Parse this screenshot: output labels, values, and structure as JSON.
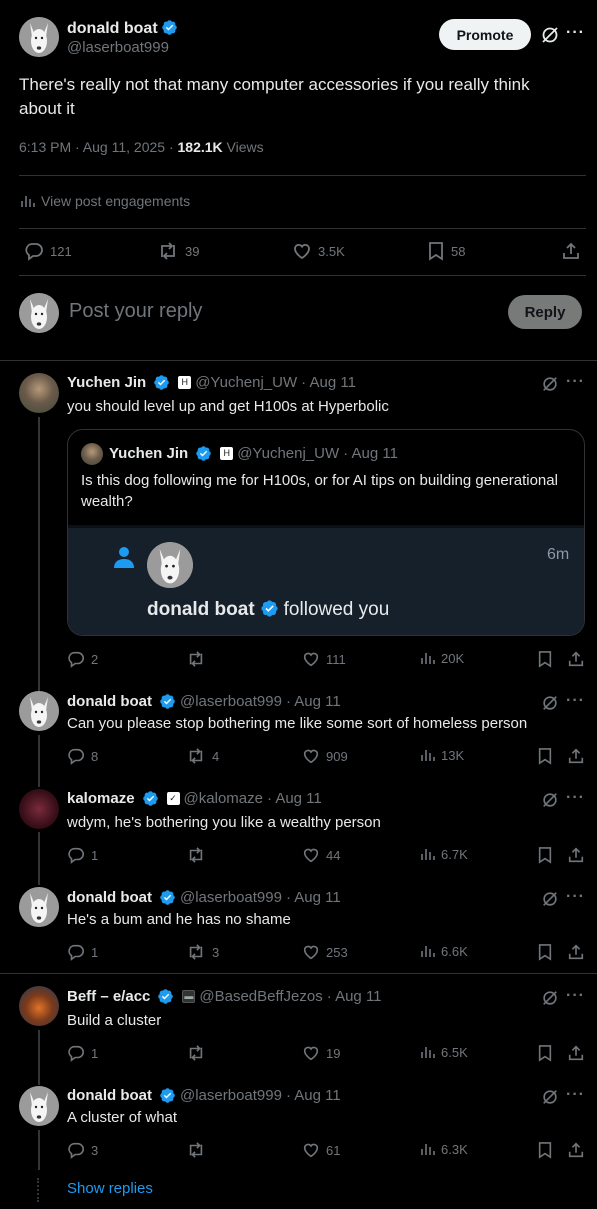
{
  "post": {
    "author_name": "donald boat",
    "author_handle": "@laserboat999",
    "promote_label": "Promote",
    "text_line1": "There's really not that many computer accessories if you really think",
    "text_line2": "about it",
    "time": "6:13 PM · Aug 11, 2025 · ",
    "views_count": "182.1K",
    "views_label": " Views",
    "engagements_label": "View post engagements",
    "metrics": {
      "replies": "121",
      "reposts": "39",
      "likes": "3.5K",
      "bookmarks": "58"
    }
  },
  "composer": {
    "placeholder": "Post your reply",
    "reply_label": "Reply"
  },
  "replies": [
    {
      "name": "Yuchen Jin",
      "handle": "@Yuchenj_UW",
      "date": "· Aug 11",
      "text": "you should level up and get H100s at Hyperbolic",
      "metrics": {
        "replies": "2",
        "reposts": "",
        "likes": "111",
        "views": "20K"
      },
      "quote": {
        "name": "Yuchen Jin",
        "handle": "@Yuchenj_UW",
        "date": "· Aug 11",
        "text_line1": "Is this dog following me for H100s, or for AI tips on building generational",
        "text_line2": "wealth?",
        "notification": {
          "name": "donald boat",
          "action": "followed you",
          "time": "6m"
        }
      }
    },
    {
      "name": "donald boat",
      "handle": "@laserboat999",
      "date": "· Aug 11",
      "text": "Can you please stop bothering me like some sort of homeless person",
      "metrics": {
        "replies": "8",
        "reposts": "4",
        "likes": "909",
        "views": "13K"
      }
    },
    {
      "name": "kalomaze",
      "handle": "@kalomaze",
      "date": "· Aug 11",
      "text": "wdym, he's bothering you like a wealthy person",
      "metrics": {
        "replies": "1",
        "reposts": "",
        "likes": "44",
        "views": "6.7K"
      }
    },
    {
      "name": "donald boat",
      "handle": "@laserboat999",
      "date": "· Aug 11",
      "text": "He's a bum and he has no shame",
      "metrics": {
        "replies": "1",
        "reposts": "3",
        "likes": "253",
        "views": "6.6K"
      }
    },
    {
      "name": "Beff – e/acc",
      "handle": "@BasedBeffJezos",
      "date": "· Aug 11",
      "text": "Build a cluster",
      "metrics": {
        "replies": "1",
        "reposts": "",
        "likes": "19",
        "views": "6.5K"
      }
    },
    {
      "name": "donald boat",
      "handle": "@laserboat999",
      "date": "· Aug 11",
      "text": "A cluster of what",
      "metrics": {
        "replies": "3",
        "reposts": "",
        "likes": "61",
        "views": "6.3K"
      }
    }
  ],
  "show_replies_label": "Show replies",
  "colors": {
    "accent": "#1d9bf0",
    "background": "#000000",
    "border": "#2f3336",
    "muted": "#71767b"
  }
}
